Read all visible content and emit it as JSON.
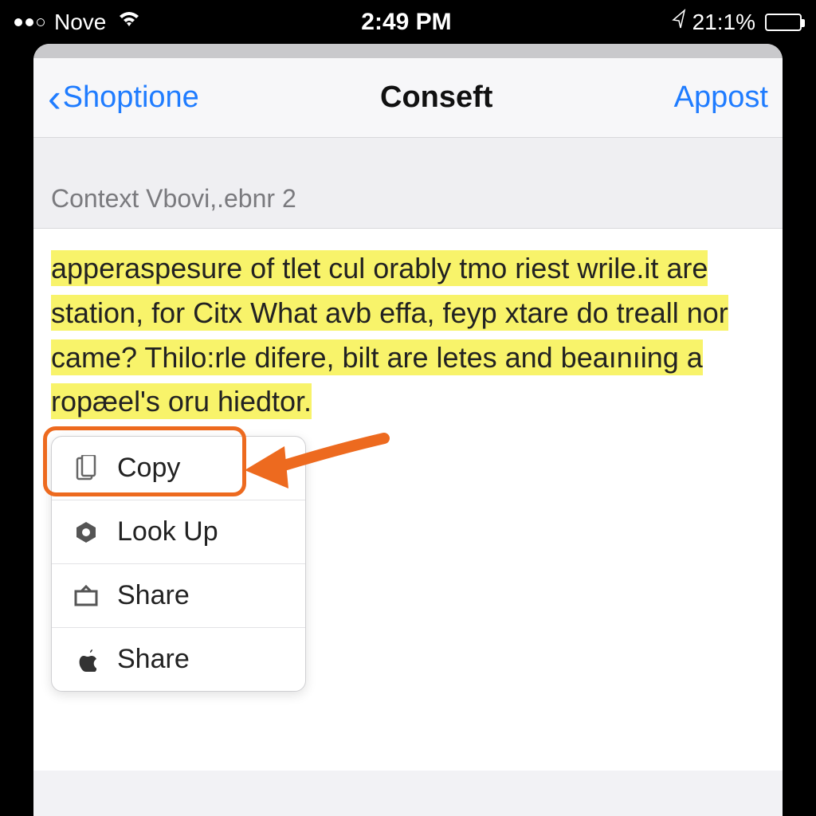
{
  "status_bar": {
    "carrier": "Nove",
    "time": "2:49 PM",
    "battery_text": "21:1%"
  },
  "nav": {
    "back_label": "Shoptione",
    "title": "Conseft",
    "action_label": "Appost"
  },
  "subheader": {
    "text": "Context Vbovi,.ebnr 2"
  },
  "body": {
    "highlighted_text": "apperaspesure of tlet cul orably tmo riest wrile.it are station, for Citx What avb effa, feyp xtare do treall nor came? Thilo:rle difere, bilt are letes and beaınıing a ropæel's oru hiedtor."
  },
  "context_menu": {
    "items": [
      {
        "icon": "copy",
        "label": "Copy"
      },
      {
        "icon": "lookup",
        "label": "Look Up"
      },
      {
        "icon": "share",
        "label": "Share"
      },
      {
        "icon": "apple",
        "label": "Share"
      }
    ]
  },
  "annotation": {
    "highlight_color": "#ed6a1f"
  }
}
